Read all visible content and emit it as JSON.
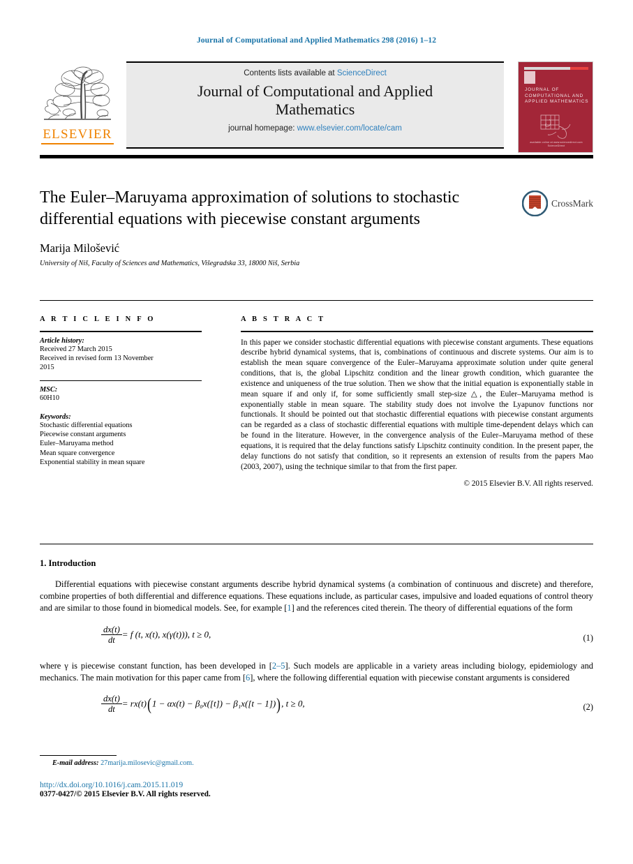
{
  "running_head": "Journal of Computational and Applied Mathematics 298 (2016) 1–12",
  "masthead": {
    "contents_prefix": "Contents lists available at ",
    "sciencedirect": "ScienceDirect",
    "journal_name": "Journal of Computational and Applied Mathematics",
    "homepage_prefix": "journal homepage: ",
    "homepage_url": "www.elsevier.com/locate/cam",
    "publisher": "ELSEVIER",
    "cover_title": "JOURNAL OF COMPUTATIONAL AND APPLIED MATHEMATICS",
    "cover_footer": "available online at www.sciencedirect.com ScienceDirect"
  },
  "colors": {
    "link_blue": "#1a74a8",
    "sciencedirect_blue": "#2e80bd",
    "elsevier_orange": "#ef8200",
    "cover_red": "#a32638",
    "masthead_grey": "#eaeaea"
  },
  "title_block": {
    "title": "The Euler–Maruyama approximation of solutions to stochastic differential equations with piecewise constant arguments",
    "author": "Marija Milošević",
    "affiliation": "University of Niš, Faculty of Sciences and Mathematics, Višegradska 33, 18000 Niš, Serbia"
  },
  "crossmark": {
    "label": "CrossMark"
  },
  "article_info": {
    "heading": "A R T I C L E    I N F O",
    "history_label": "Article history:",
    "history_lines": [
      "Received 27 March 2015",
      "Received in revised form 13 November",
      "2015"
    ],
    "msc_label": "MSC:",
    "msc_value": "60H10",
    "keywords_label": "Keywords:",
    "keywords": [
      "Stochastic differential equations",
      "Piecewise constant arguments",
      "Euler–Maruyama method",
      "Mean square convergence",
      "Exponential stability in mean square"
    ]
  },
  "abstract": {
    "heading": "A B S T R A C T",
    "text": "In this paper we consider stochastic differential equations with piecewise constant arguments. These equations describe hybrid dynamical systems, that is, combinations of continuous and discrete systems. Our aim is to establish the mean square convergence of the Euler–Maruyama approximate solution under quite general conditions, that is, the global Lipschitz condition and the linear growth condition, which guarantee the existence and uniqueness of the true solution. Then we show that the initial equation is exponentially stable in mean square if and only if, for some sufficiently small step-size △, the Euler–Maruyama method is exponentially stable in mean square. The stability study does not involve the Lyapunov functions nor functionals. It should be pointed out that stochastic differential equations with piecewise constant arguments can be regarded as a class of stochastic differential equations with multiple time-dependent delays which can be found in the literature. However, in the convergence analysis of the Euler–Maruyama method of these equations, it is required that the delay functions satisfy Lipschitz continuity condition. In the present paper, the delay functions do not satisfy that condition, so it represents an extension of results from the papers Mao (2003, 2007), using the technique similar to that from the first paper.",
    "copyright": "© 2015 Elsevier B.V. All rights reserved."
  },
  "body": {
    "section_heading": "1. Introduction",
    "para1_a": "Differential equations with piecewise constant arguments describe hybrid dynamical systems (a combination of continuous and discrete) and therefore, combine properties of both differential and difference equations. These equations include, as particular cases, impulsive and loaded equations of control theory and are similar to those found in biomedical models. See, for example [",
    "para1_ref": "1",
    "para1_b": "] and the references cited therein. The theory of differential equations of the form",
    "eq1": {
      "num_text": "dx(t)",
      "den_text": "dt",
      "rhs": "= f (t, x(t), x(γ(t))),    t ≥ 0,",
      "number": "(1)"
    },
    "para2_a": "where γ is piecewise constant function, has been developed in [",
    "para2_ref1": "2–5",
    "para2_b": "]. Such models are applicable in a variety areas including biology, epidemiology and mechanics. The main motivation for this paper came from [",
    "para2_ref2": "6",
    "para2_c": "], where the following differential equation with piecewise constant arguments is considered",
    "eq2": {
      "num_text": "dx(t)",
      "den_text": "dt",
      "rhs_pre": "= rx(t)",
      "rhs_inner": "1 − αx(t) − β₀x([t]) − β₁x([t − 1])",
      "rhs_post": ",    t ≥ 0,",
      "number": "(2)"
    }
  },
  "footer": {
    "footnote_label": "E-mail address:",
    "footnote_email": "27marija.milosevic@gmail.com.",
    "doi": "http://dx.doi.org/10.1016/j.cam.2015.11.019",
    "issn": "0377-0427/© 2015 Elsevier B.V. All rights reserved."
  }
}
